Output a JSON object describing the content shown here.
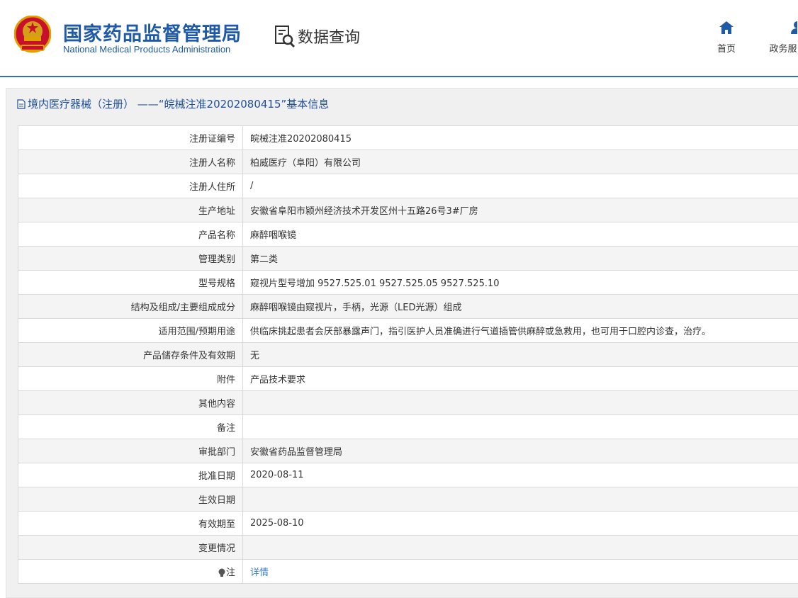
{
  "header": {
    "site_title_cn": "国家药品监督管理局",
    "site_title_en": "National Medical Products Administration",
    "query_label": "数据查询",
    "nav": [
      {
        "label": "首页",
        "icon": "home-icon"
      },
      {
        "label": "政务服",
        "icon": "user-icon"
      }
    ],
    "brand_color": "#1f5aa8"
  },
  "panel": {
    "title": "境内医疗器械（注册） ——“皖械注准20202080415”基本信息"
  },
  "rows": [
    {
      "label": "注册证编号",
      "value": "皖械注准20202080415"
    },
    {
      "label": "注册人名称",
      "value": "柏威医疗（阜阳）有限公司"
    },
    {
      "label": "注册人住所",
      "value": "/"
    },
    {
      "label": "生产地址",
      "value": "安徽省阜阳市颍州经济技术开发区州十五路26号3#厂房"
    },
    {
      "label": "产品名称",
      "value": "麻醉咽喉镜"
    },
    {
      "label": "管理类别",
      "value": "第二类"
    },
    {
      "label": "型号规格",
      "value": "窥视片型号增加 9527.525.01 9527.525.05 9527.525.10"
    },
    {
      "label": "结构及组成/主要组成成分",
      "value": "麻醉咽喉镜由窥视片，手柄，光源（LED光源）组成"
    },
    {
      "label": "适用范围/预期用途",
      "value": "供临床挑起患者会厌部暴露声门，指引医护人员准确进行气道插管供麻醉或急救用，也可用于口腔内诊查，治疗。"
    },
    {
      "label": "产品储存条件及有效期",
      "value": "无"
    },
    {
      "label": "附件",
      "value": "产品技术要求"
    },
    {
      "label": "其他内容",
      "value": ""
    },
    {
      "label": "备注",
      "value": ""
    },
    {
      "label": "审批部门",
      "value": "安徽省药品监督管理局"
    },
    {
      "label": "批准日期",
      "value": "2020-08-11"
    },
    {
      "label": "生效日期",
      "value": ""
    },
    {
      "label": "有效期至",
      "value": "2025-08-10"
    },
    {
      "label": "变更情况",
      "value": ""
    }
  ],
  "note_row": {
    "label": "注",
    "link": "详情",
    "icon": "lightbulb-icon"
  }
}
